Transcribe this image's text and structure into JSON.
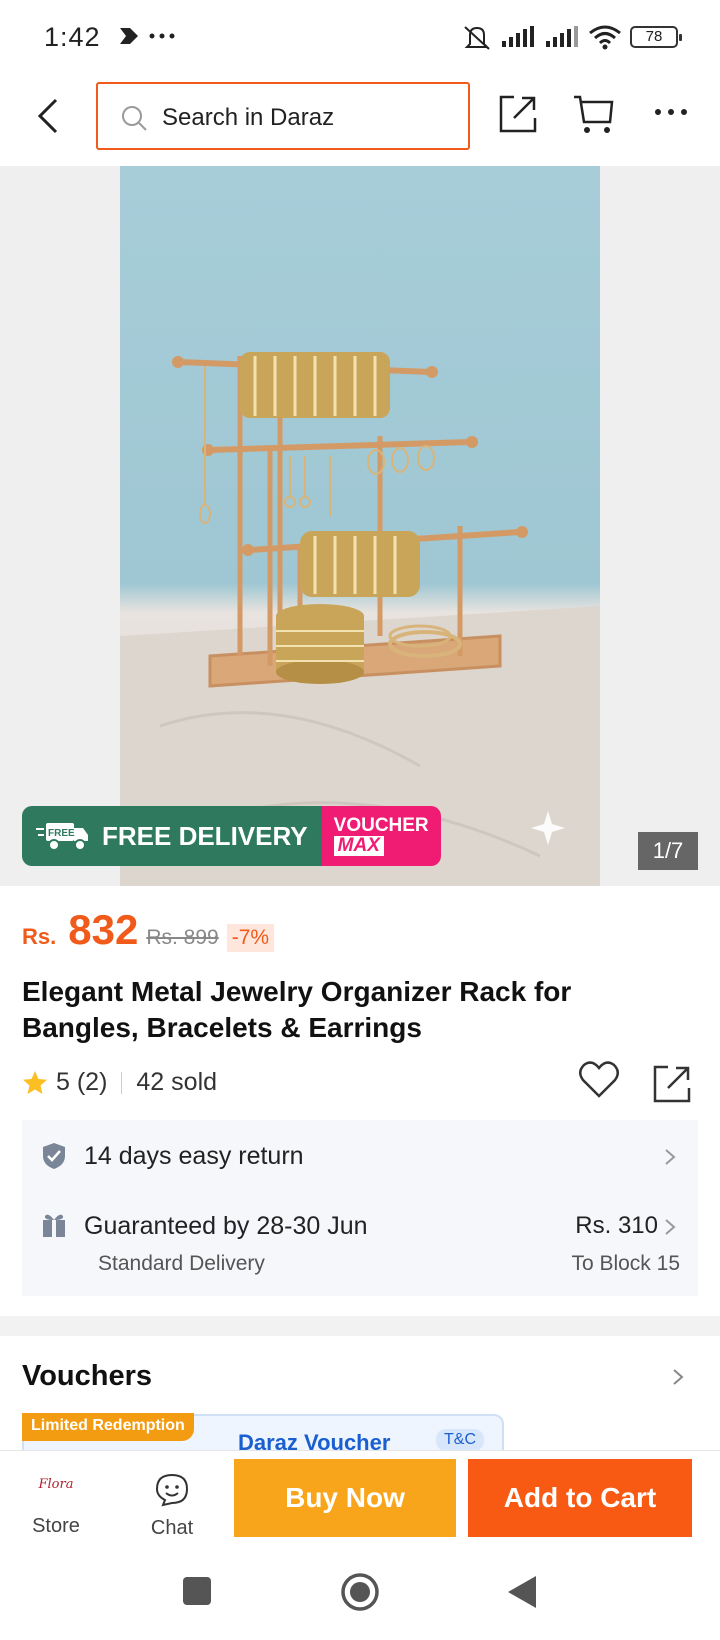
{
  "status_bar": {
    "time": "1:42",
    "battery": "78"
  },
  "search": {
    "placeholder": "Search in Daraz"
  },
  "gallery": {
    "badge_free_small": "FREE",
    "badge_free": "FREE DELIVERY",
    "badge_voucher_top": "VOUCHER",
    "badge_voucher_bottom": "MAX",
    "counter": "1/7"
  },
  "product": {
    "currency": "Rs.",
    "price": "832",
    "old_price": "Rs. 899",
    "discount": "-7%",
    "title": "Elegant Metal Jewelry Organizer Rack for Bangles, Bracelets & Earrings",
    "rating": "5 (2)",
    "sold": "42 sold"
  },
  "service": {
    "return": "14 days easy return",
    "guarantee": "Guaranteed by 28-30 Jun",
    "delivery_type": "Standard Delivery",
    "delivery_fee": "Rs. 310",
    "location": "To Block 15"
  },
  "vouchers": {
    "title": "Vouchers",
    "limited": "Limited Redemption",
    "card_text": "Daraz Voucher",
    "tnc": "T&C"
  },
  "bottom_bar": {
    "store_label": "Store",
    "chat_label": "Chat",
    "buy_now": "Buy Now",
    "add_to_cart": "Add to Cart",
    "store_logo_text": "Flora"
  },
  "colors": {
    "accent": "#f05a1a",
    "buy_now": "#f9a51b",
    "add_to_cart": "#f85a14"
  }
}
